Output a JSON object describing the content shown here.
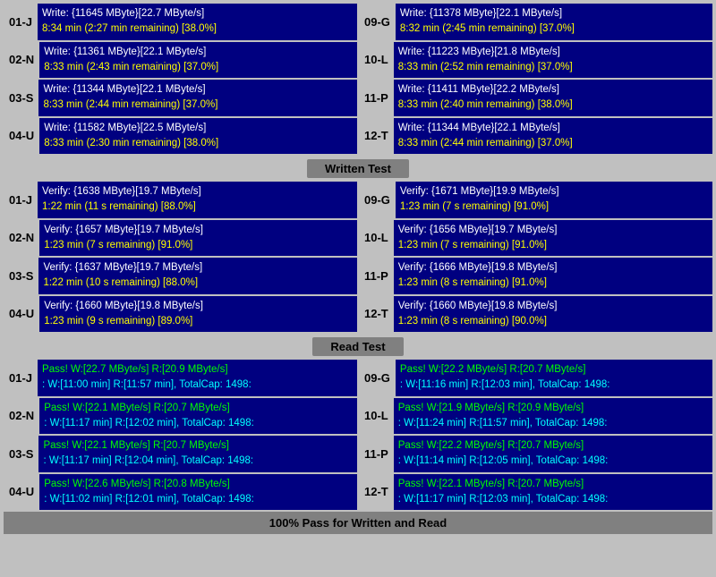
{
  "sections": {
    "write_test": {
      "label": "Written Test",
      "rows": [
        {
          "left_id": "01-J",
          "left_line1": "Write: {11645 MByte}[22.7 MByte/s]",
          "left_line2": "8:34 min (2:27 min remaining)  [38.0%]",
          "right_id": "09-G",
          "right_line1": "Write: {11378 MByte}[22.1 MByte/s]",
          "right_line2": "8:32 min (2:45 min remaining)   [37.0%]"
        },
        {
          "left_id": "02-N",
          "left_line1": "Write: {11361 MByte}[22.1 MByte/s]",
          "left_line2": "8:33 min (2:43 min remaining)  [37.0%]",
          "right_id": "10-L",
          "right_line1": "Write: {11223 MByte}[21.8 MByte/s]",
          "right_line2": "8:33 min (2:52 min remaining)  [37.0%]"
        },
        {
          "left_id": "03-S",
          "left_line1": "Write: {11344 MByte}[22.1 MByte/s]",
          "left_line2": "8:33 min (2:44 min remaining)  [37.0%]",
          "right_id": "11-P",
          "right_line1": "Write: {11411 MByte}[22.2 MByte/s]",
          "right_line2": "8:33 min (2:40 min remaining)  [38.0%]"
        },
        {
          "left_id": "04-U",
          "left_line1": "Write: {11582 MByte}[22.5 MByte/s]",
          "left_line2": "8:33 min (2:30 min remaining)  [38.0%]",
          "right_id": "12-T",
          "right_line1": "Write: {11344 MByte}[22.1 MByte/s]",
          "right_line2": "8:33 min (2:44 min remaining)  [37.0%]"
        }
      ]
    },
    "verify_test": {
      "label": "Written Test",
      "rows": [
        {
          "left_id": "01-J",
          "left_line1": "Verify: {1638 MByte}[19.7 MByte/s]",
          "left_line2": "1:22 min (11 s remaining)   [88.0%]",
          "right_id": "09-G",
          "right_line1": "Verify: {1671 MByte}[19.9 MByte/s]",
          "right_line2": "1:23 min (7 s remaining)   [91.0%]"
        },
        {
          "left_id": "02-N",
          "left_line1": "Verify: {1657 MByte}[19.7 MByte/s]",
          "left_line2": "1:23 min (7 s remaining)   [91.0%]",
          "right_id": "10-L",
          "right_line1": "Verify: {1656 MByte}[19.7 MByte/s]",
          "right_line2": "1:23 min (7 s remaining)   [91.0%]"
        },
        {
          "left_id": "03-S",
          "left_line1": "Verify: {1637 MByte}[19.7 MByte/s]",
          "left_line2": "1:22 min (10 s remaining)   [88.0%]",
          "right_id": "11-P",
          "right_line1": "Verify: {1666 MByte}[19.8 MByte/s]",
          "right_line2": "1:23 min (8 s remaining)   [91.0%]"
        },
        {
          "left_id": "04-U",
          "left_line1": "Verify: {1660 MByte}[19.8 MByte/s]",
          "left_line2": "1:23 min (9 s remaining)   [89.0%]",
          "right_id": "12-T",
          "right_line1": "Verify: {1660 MByte}[19.8 MByte/s]",
          "right_line2": "1:23 min (8 s remaining)   [90.0%]"
        }
      ]
    },
    "read_test": {
      "label": "Read Test",
      "rows": [
        {
          "left_id": "01-J",
          "left_line1": "Pass! W:[22.7 MByte/s] R:[20.9 MByte/s]",
          "left_line2": ": W:[11:00 min] R:[11:57 min], TotalCap: 1498:",
          "right_id": "09-G",
          "right_line1": "Pass! W:[22.2 MByte/s] R:[20.7 MByte/s]",
          "right_line2": ": W:[11:16 min] R:[12:03 min], TotalCap: 1498:"
        },
        {
          "left_id": "02-N",
          "left_line1": "Pass! W:[22.1 MByte/s] R:[20.7 MByte/s]",
          "left_line2": ": W:[11:17 min] R:[12:02 min], TotalCap: 1498:",
          "right_id": "10-L",
          "right_line1": "Pass! W:[21.9 MByte/s] R:[20.9 MByte/s]",
          "right_line2": ": W:[11:24 min] R:[11:57 min], TotalCap: 1498:"
        },
        {
          "left_id": "03-S",
          "left_line1": "Pass! W:[22.1 MByte/s] R:[20.7 MByte/s]",
          "left_line2": ": W:[11:17 min] R:[12:04 min], TotalCap: 1498:",
          "right_id": "11-P",
          "right_line1": "Pass! W:[22.2 MByte/s] R:[20.7 MByte/s]",
          "right_line2": ": W:[11:14 min] R:[12:05 min], TotalCap: 1498:"
        },
        {
          "left_id": "04-U",
          "left_line1": "Pass! W:[22.6 MByte/s] R:[20.8 MByte/s]",
          "left_line2": ": W:[11:02 min] R:[12:01 min], TotalCap: 1498:",
          "right_id": "12-T",
          "right_line1": "Pass! W:[22.1 MByte/s] R:[20.7 MByte/s]",
          "right_line2": ": W:[11:17 min] R:[12:03 min], TotalCap: 1498:"
        }
      ]
    }
  },
  "dividers": {
    "write": "Written Test",
    "read": "Read Test"
  },
  "footer": "100% Pass for Written and Read"
}
